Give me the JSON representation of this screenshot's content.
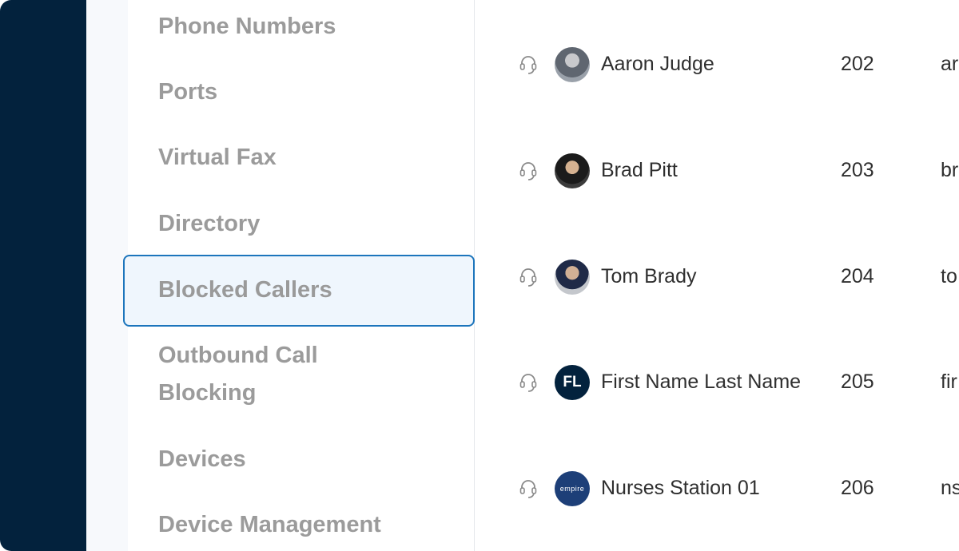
{
  "menu": {
    "items": [
      {
        "label": "Phone Numbers"
      },
      {
        "label": "Ports"
      },
      {
        "label": "Virtual Fax"
      },
      {
        "label": "Directory"
      },
      {
        "label": "Blocked Callers",
        "selected": true
      },
      {
        "label": "Outbound Call Blocking"
      },
      {
        "label": "Devices"
      },
      {
        "label": "Device Management"
      }
    ]
  },
  "users": [
    {
      "name": "Aaron Judge",
      "extension": "202",
      "email_start": "ar",
      "avatar": "photo",
      "icon": "headset-icon"
    },
    {
      "name": "Brad Pitt",
      "extension": "203",
      "email_start": "br",
      "avatar": "photo",
      "icon": "headset-icon"
    },
    {
      "name": "Tom Brady",
      "extension": "204",
      "email_start": "to",
      "avatar": "photo",
      "icon": "headset-icon"
    },
    {
      "name": "First Name Last Name",
      "extension": "205",
      "email_start": "fir",
      "avatar_initials": "FL",
      "icon": "headset-icon"
    },
    {
      "name": "Nurses Station 01",
      "extension": "206",
      "email_start": "ns",
      "avatar_logo": "empire",
      "icon": "headset-icon"
    }
  ],
  "colors": {
    "rail": "#03223d",
    "selected_border": "#1c75bc",
    "selected_fill": "#eff6fd",
    "menu_text": "#9b9b9b"
  }
}
